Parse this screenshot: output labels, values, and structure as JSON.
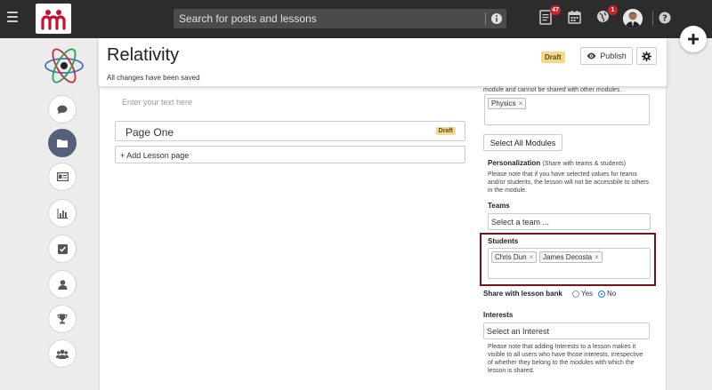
{
  "topbar": {
    "search_placeholder": "Search for posts and lessons",
    "notifications_count": "47",
    "globe_count": "1"
  },
  "header": {
    "title": "Relativity",
    "saved_status": "All changes have been saved",
    "draft_label": "Draft",
    "publish_label": "Publish"
  },
  "editor": {
    "text_placeholder": "Enter your text here",
    "pages": [
      {
        "title": "Page One",
        "badge": "Draft"
      }
    ],
    "add_page_label": "+ Add Lesson page"
  },
  "settings": {
    "module_note": "module and cannot be shared with other modules.",
    "modules": [
      "Physics"
    ],
    "select_all_label": "Select All Modules",
    "personalization_title": "Personalization",
    "personalization_sub": "(Share with teams & students)",
    "personalization_note": "Please note that if you have selected values for teams and/or students, the lesson will not be accessbile to others in the module.",
    "teams_label": "Teams",
    "teams_placeholder": "Select a team ...",
    "students_label": "Students",
    "students": [
      "Chris Dun",
      "James Decosta"
    ],
    "share_label": "Share with lesson bank",
    "share_yes": "Yes",
    "share_no": "No",
    "share_value": "No",
    "interests_label": "Interests",
    "interests_placeholder": "Select an Interest",
    "interests_note": "Please note that adding Interests to a lesson makes it visible to all users who have those interests, irrespective of whether they belong to the modules with which the lesson is shared."
  },
  "colors": {
    "topbar": "#2c2c2c",
    "draft_badge": "#f5d98b",
    "highlight": "#7a1018",
    "active_rail": "#57607a",
    "brand_red": "#c8102e",
    "radio_on": "#2b85e4"
  },
  "icons": {
    "rail": [
      "comment-icon",
      "folder-icon",
      "id-card-icon",
      "bar-chart-icon",
      "checkbox-icon",
      "user-icon",
      "trophy-icon",
      "group-icon"
    ]
  }
}
